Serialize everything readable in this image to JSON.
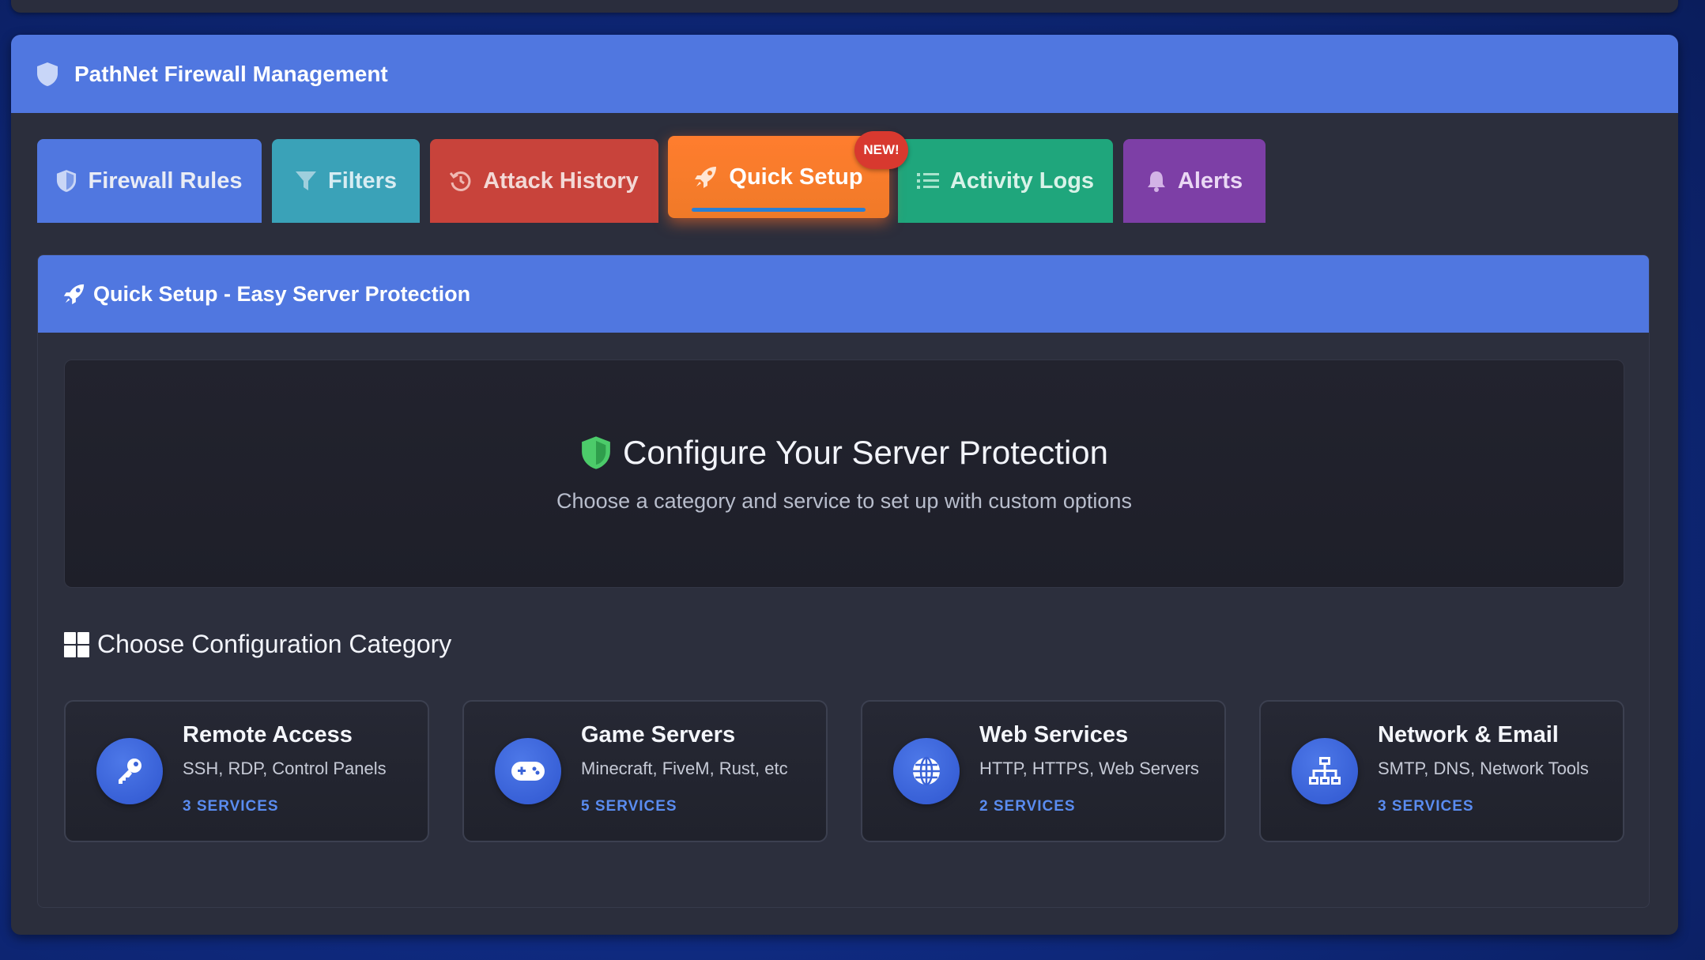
{
  "app": {
    "title": "PathNet Firewall Management"
  },
  "tabs": [
    {
      "label": "Firewall Rules",
      "icon": "shield-icon",
      "color": "#5077e0"
    },
    {
      "label": "Filters",
      "icon": "filter-icon",
      "color": "#3aa2b8"
    },
    {
      "label": "Attack History",
      "icon": "history-icon",
      "color": "#c8433b"
    },
    {
      "label": "Quick Setup",
      "icon": "rocket-icon",
      "color": "#ff7d2e",
      "active": true,
      "badge": "NEW!"
    },
    {
      "label": "Activity Logs",
      "icon": "list-icon",
      "color": "#1fa67c"
    },
    {
      "label": "Alerts",
      "icon": "bell-icon",
      "color": "#7d3fa6"
    }
  ],
  "quick_setup": {
    "header": "Quick Setup - Easy Server Protection",
    "hero_title": "Configure Your Server Protection",
    "hero_subtitle": "Choose a category and service to set up with custom options",
    "section_title": "Choose Configuration Category",
    "categories": [
      {
        "name": "Remote Access",
        "desc": "SSH, RDP, Control Panels",
        "count": "3 SERVICES",
        "icon": "key-icon"
      },
      {
        "name": "Game Servers",
        "desc": "Minecraft, FiveM, Rust, etc",
        "count": "5 SERVICES",
        "icon": "gamepad-icon"
      },
      {
        "name": "Web Services",
        "desc": "HTTP, HTTPS, Web Servers",
        "count": "2 SERVICES",
        "icon": "globe-icon"
      },
      {
        "name": "Network & Email",
        "desc": "SMTP, DNS, Network Tools",
        "count": "3 SERVICES",
        "icon": "network-icon"
      }
    ]
  },
  "colors": {
    "accent": "#5077e0",
    "success": "#4ccb6a",
    "count": "#5a8cf0"
  }
}
